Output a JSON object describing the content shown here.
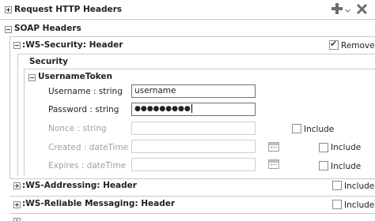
{
  "sections": {
    "http_headers": "Request HTTP Headers",
    "soap_headers": "SOAP Headers",
    "ws_security": ":WS-Security: Header",
    "security": "Security",
    "username_token": "UsernameToken",
    "ws_addressing": ":WS-Addressing: Header",
    "ws_reliable": ":WS-Reliable Messaging: Header"
  },
  "toolbar": {
    "add_icon": "plus-icon",
    "dropdown_icon": "chevron-down-icon",
    "remove_icon": "close-icon"
  },
  "remove_label": "Remove",
  "fields": {
    "username": {
      "label": "Username : string",
      "value": "username"
    },
    "password": {
      "label": "Password : string",
      "value": "●●●●●●●●●"
    },
    "nonce": {
      "label": "Nonce : string",
      "value": ""
    },
    "created": {
      "label": "Created : dateTime",
      "value": ""
    },
    "expires": {
      "label": "Expires : dateTime",
      "value": ""
    }
  },
  "include_label": "Include"
}
